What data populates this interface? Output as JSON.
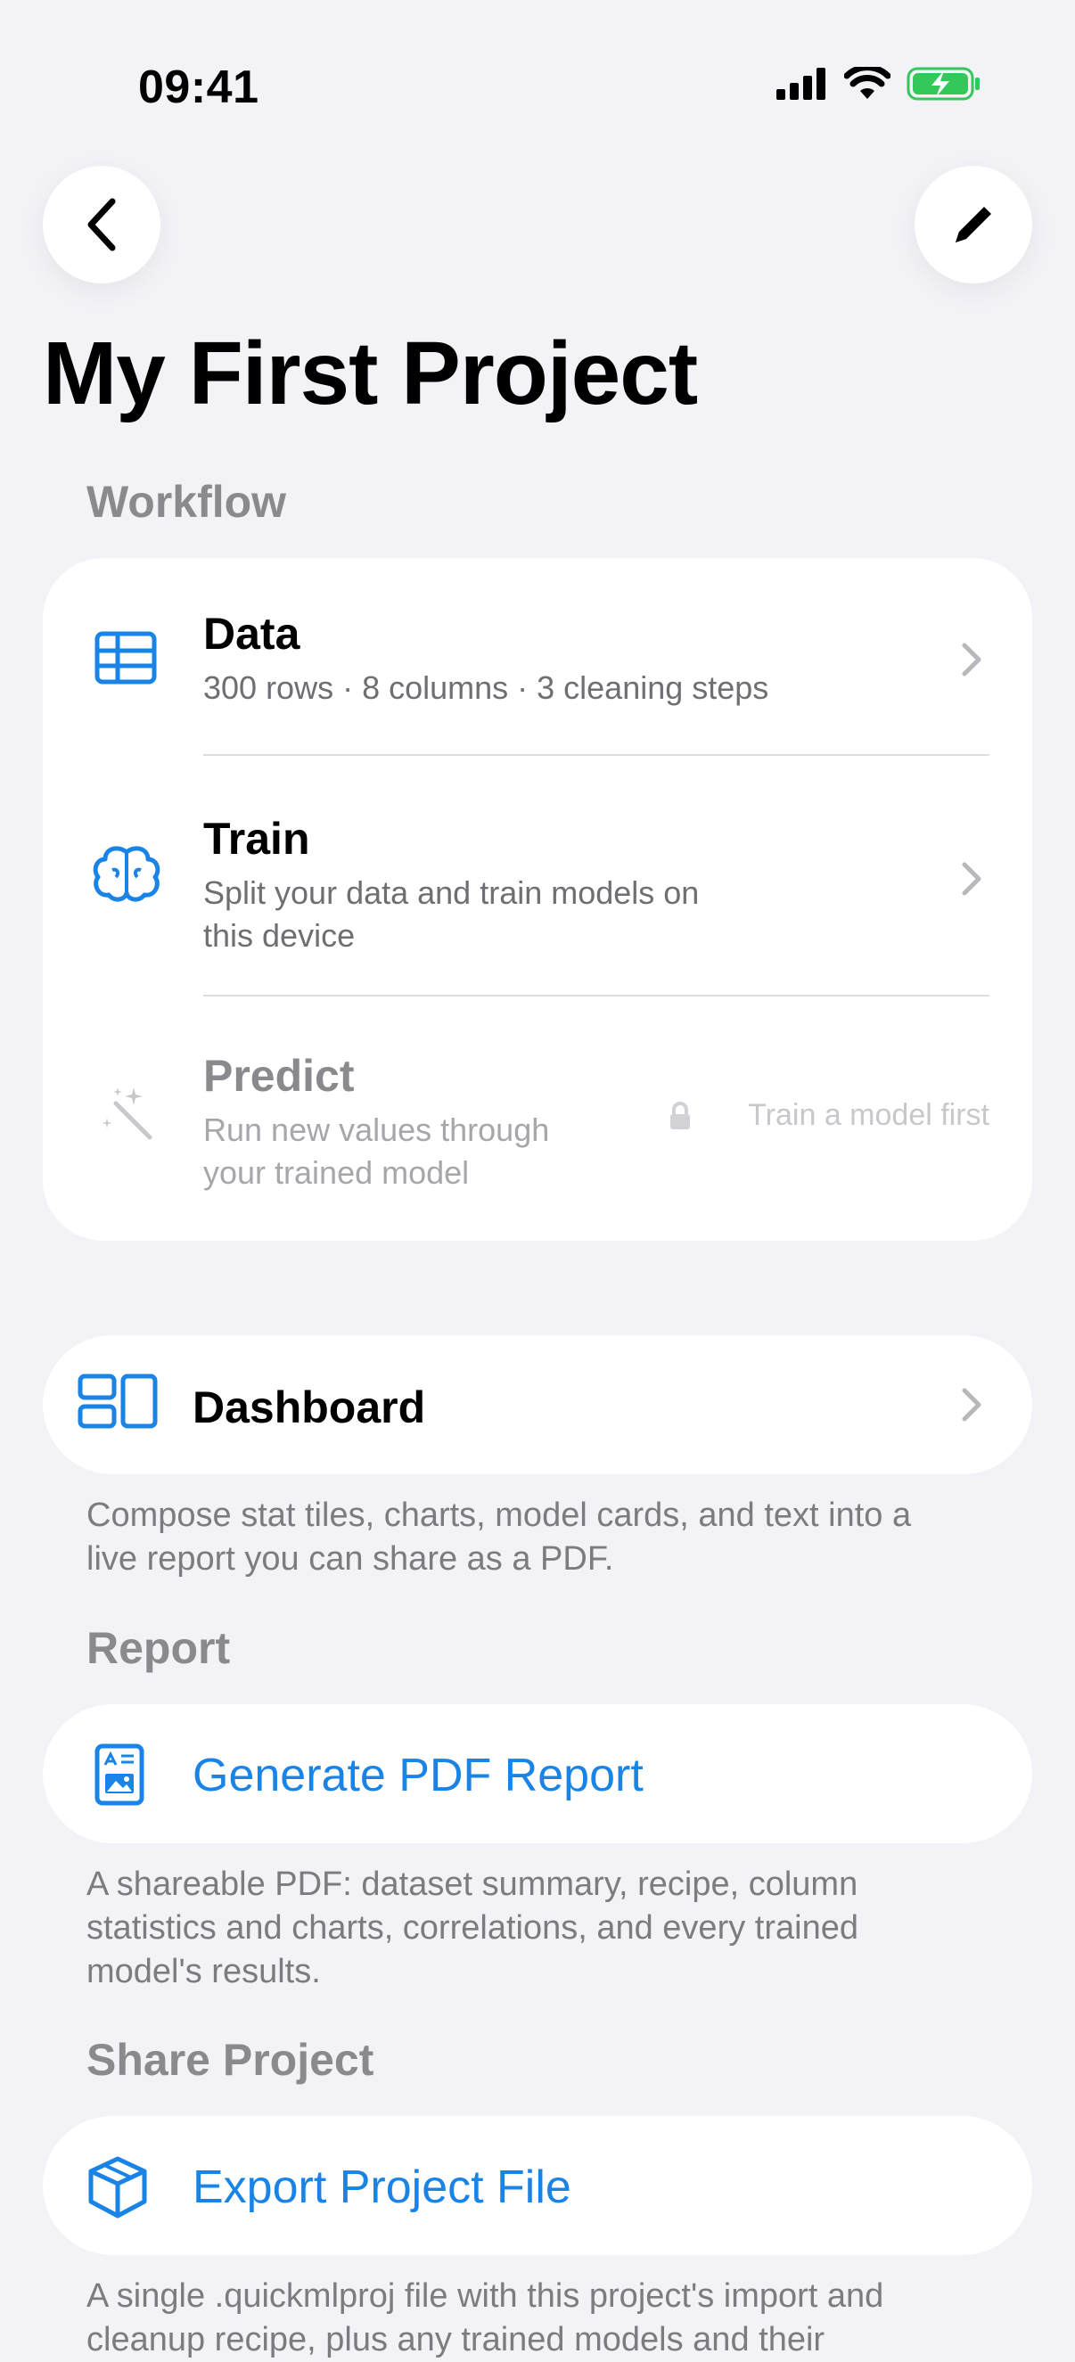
{
  "status": {
    "time": "09:41"
  },
  "header": {
    "title": "My First Project"
  },
  "workflow": {
    "header": "Workflow",
    "rows": [
      {
        "title": "Data",
        "subtitle": "300 rows · 8 columns · 3 cleaning steps"
      },
      {
        "title": "Train",
        "subtitle_line1": "Split your data and train models on",
        "subtitle_line2": "this device"
      },
      {
        "title": "Predict",
        "subtitle_line1": "Run new values through",
        "subtitle_line2": "your trained model",
        "locked_hint": "Train a model first"
      }
    ]
  },
  "dashboard": {
    "label": "Dashboard",
    "footnote_line1": "Compose stat tiles, charts, model cards, and text into a",
    "footnote_line2": "live report you can share as a PDF."
  },
  "report": {
    "header": "Report",
    "button_label": "Generate PDF Report",
    "footnote_line1": "A shareable PDF: dataset summary, recipe, column",
    "footnote_line2": "statistics and charts, correlations, and every trained",
    "footnote_line3": "model's results."
  },
  "share": {
    "header": "Share Project",
    "button_label": "Export Project File",
    "footnote_line1": "A single .quickmlproj file with this project's import and",
    "footnote_line2": "cleanup recipe, plus any trained models and their"
  },
  "colors": {
    "accent": "#1a84e6",
    "background": "#f2f2f7",
    "battery": "#34c759"
  },
  "icons": [
    "back-chevron-icon",
    "pencil-icon",
    "table-icon",
    "brain-icon",
    "magic-wand-icon",
    "lock-icon",
    "dashboard-icon",
    "document-image-icon",
    "cube-icon"
  ]
}
